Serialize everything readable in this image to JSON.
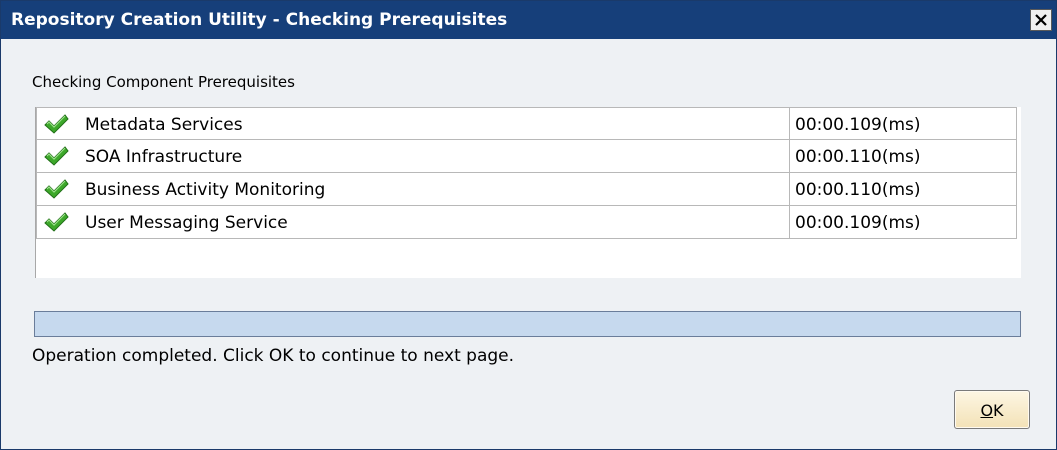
{
  "window": {
    "title": "Repository Creation Utility - Checking Prerequisites",
    "close_icon": "close-icon"
  },
  "section_label": "Checking Component Prerequisites",
  "components": [
    {
      "name": "Metadata Services",
      "time": "00:00.109(ms)",
      "status_icon": "check-icon",
      "status": "passed"
    },
    {
      "name": "SOA Infrastructure",
      "time": "00:00.110(ms)",
      "status_icon": "check-icon",
      "status": "passed"
    },
    {
      "name": "Business Activity Monitoring",
      "time": "00:00.110(ms)",
      "status_icon": "check-icon",
      "status": "passed"
    },
    {
      "name": "User Messaging Service",
      "time": "00:00.109(ms)",
      "status_icon": "check-icon",
      "status": "passed"
    }
  ],
  "progress": {
    "fraction": 1.0
  },
  "status_message": "Operation completed. Click OK to continue to next page.",
  "ok_button": {
    "label": "OK",
    "mnemonic": "O"
  },
  "colors": {
    "titlebar": "#163f7a",
    "progress_fill": "#c6d9ee",
    "check": "#3da82a"
  }
}
